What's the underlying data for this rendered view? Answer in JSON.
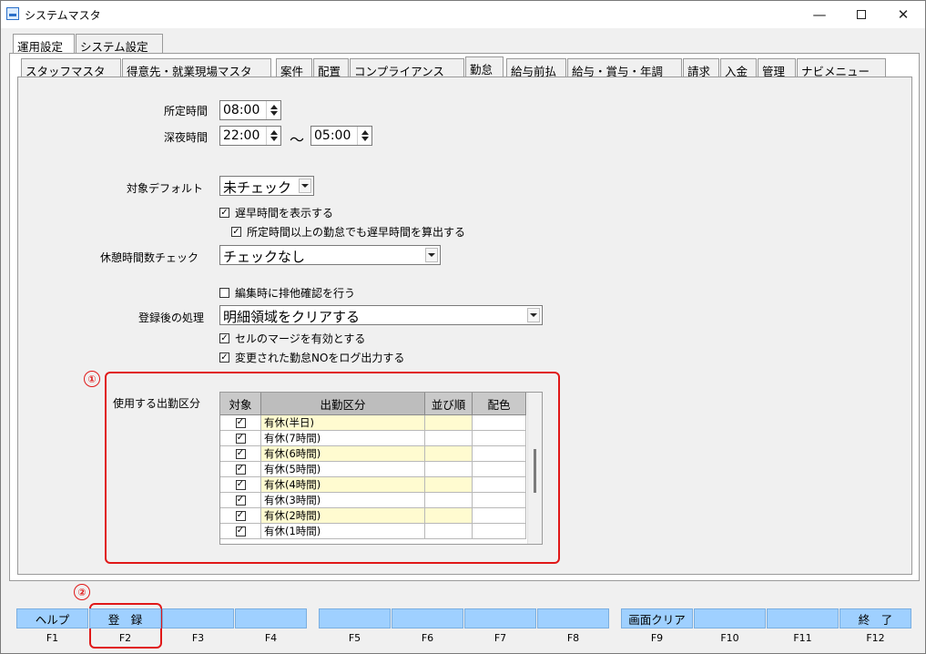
{
  "window": {
    "title": "システムマスタ",
    "controls": {
      "minimize": "—",
      "close": "✕"
    }
  },
  "main_tabs": [
    "運用設定",
    "システム設定"
  ],
  "sub_tabs": [
    "スタッフマスタ",
    "得意先・就業現場マスタ",
    "案件",
    "配置",
    "コンプライアンス",
    "勤怠",
    "給与前払",
    "給与・賞与・年調",
    "請求",
    "入金",
    "管理",
    "ナビメニュー"
  ],
  "form": {
    "standard_time_label": "所定時間",
    "standard_time": "08:00",
    "night_time_label": "深夜時間",
    "night_start": "22:00",
    "tilde": "～",
    "night_end": "05:00",
    "target_default_label": "対象デフォルト",
    "target_default_value": "未チェック",
    "show_late_label": "遅早時間を表示する",
    "show_late_checked": true,
    "calc_late_label": "所定時間以上の勤怠でも遅早時間を算出する",
    "calc_late_checked": true,
    "break_check_label": "休憩時間数チェック",
    "break_check_value": "チェックなし",
    "exclusive_label": "編集時に排他確認を行う",
    "exclusive_checked": false,
    "after_register_label": "登録後の処理",
    "after_register_value": "明細領域をクリアする",
    "cell_merge_label": "セルのマージを有効とする",
    "cell_merge_checked": true,
    "log_output_label": "変更された勤怠NOをログ出力する",
    "log_output_checked": true,
    "attendance_types_label": "使用する出勤区分"
  },
  "annotations": {
    "marker1": "①",
    "marker2": "②"
  },
  "grid": {
    "headers": [
      "対象",
      "出勤区分",
      "並び順",
      "配色"
    ],
    "rows": [
      {
        "checked": true,
        "name": "有休(半日)"
      },
      {
        "checked": true,
        "name": "有休(7時間)"
      },
      {
        "checked": true,
        "name": "有休(6時間)"
      },
      {
        "checked": true,
        "name": "有休(5時間)"
      },
      {
        "checked": true,
        "name": "有休(4時間)"
      },
      {
        "checked": true,
        "name": "有休(3時間)"
      },
      {
        "checked": true,
        "name": "有休(2時間)"
      },
      {
        "checked": true,
        "name": "有休(1時間)"
      }
    ]
  },
  "function_keys": [
    {
      "label": "ヘルプ",
      "key": "F1"
    },
    {
      "label": "登　録",
      "key": "F2"
    },
    {
      "label": "",
      "key": "F3"
    },
    {
      "label": "",
      "key": "F4"
    },
    {
      "label": "",
      "key": "F5"
    },
    {
      "label": "",
      "key": "F6"
    },
    {
      "label": "",
      "key": "F7"
    },
    {
      "label": "",
      "key": "F8"
    },
    {
      "label": "画面クリア",
      "key": "F9"
    },
    {
      "label": "",
      "key": "F10"
    },
    {
      "label": "",
      "key": "F11"
    },
    {
      "label": "終　了",
      "key": "F12"
    }
  ],
  "colors": {
    "function_button": "#9fd0ff",
    "annotation": "#e01818",
    "row_highlight": "#fffbd0"
  }
}
